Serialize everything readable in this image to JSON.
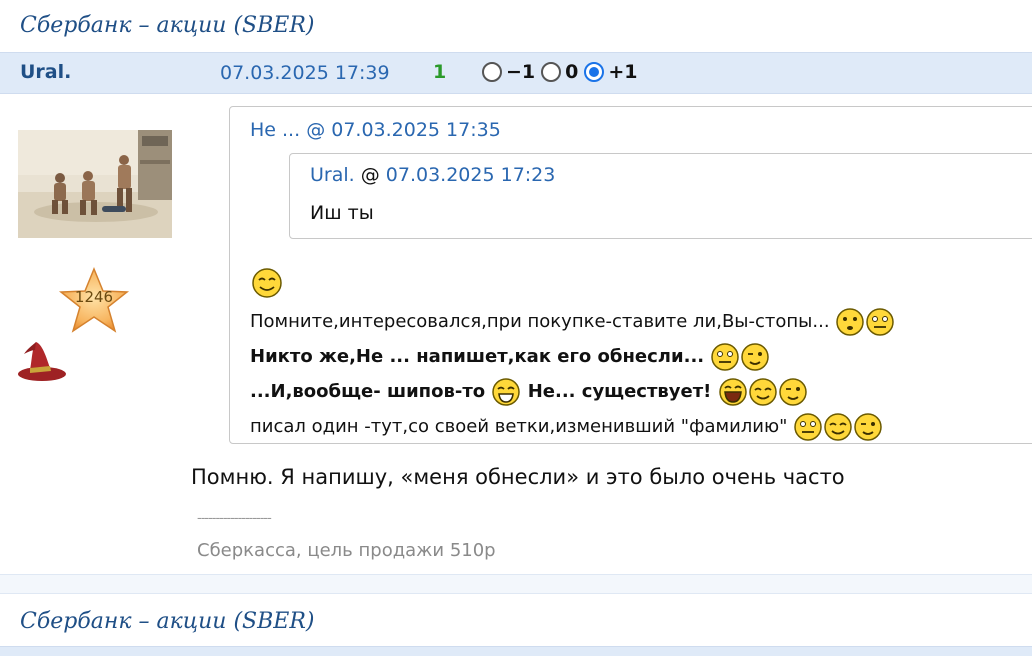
{
  "post1": {
    "topic": "Сбербанк – акции (SBER)",
    "author": "Ural.",
    "date": "07.03.2025 17:39",
    "score": "1",
    "votes": [
      {
        "label": "−1",
        "checked": false
      },
      {
        "label": "0",
        "checked": false
      },
      {
        "label": "+1",
        "checked": true
      }
    ],
    "rating": "1246",
    "quote": {
      "author": "Не ...",
      "date": "07.03.2025 17:35",
      "inner": {
        "author": "Ural.",
        "date": "07.03.2025 17:23",
        "text": "Иш ты"
      },
      "lines": [
        "Помните,интересовался,при покупке-ставите ли,Вы-стопы...",
        "Никто же,Не ... напишет,как его обнесли...",
        "...И,вообще- шипов-то",
        "Не... существует!",
        "писал один -тут,со своей ветки,изменивший \"фамилию\""
      ]
    },
    "reply": "Помню. Я напишу, «меня обнесли» и это было очень часто",
    "signature_sep": "--------------------",
    "signature": "Сберкасса, цель продажи 510р"
  },
  "post2": {
    "topic": "Сбербанк – акции (SBER)"
  },
  "colors": {
    "link": "#2a67b0",
    "header_bg": "#dfeaf8",
    "score": "#2a9a2a"
  }
}
